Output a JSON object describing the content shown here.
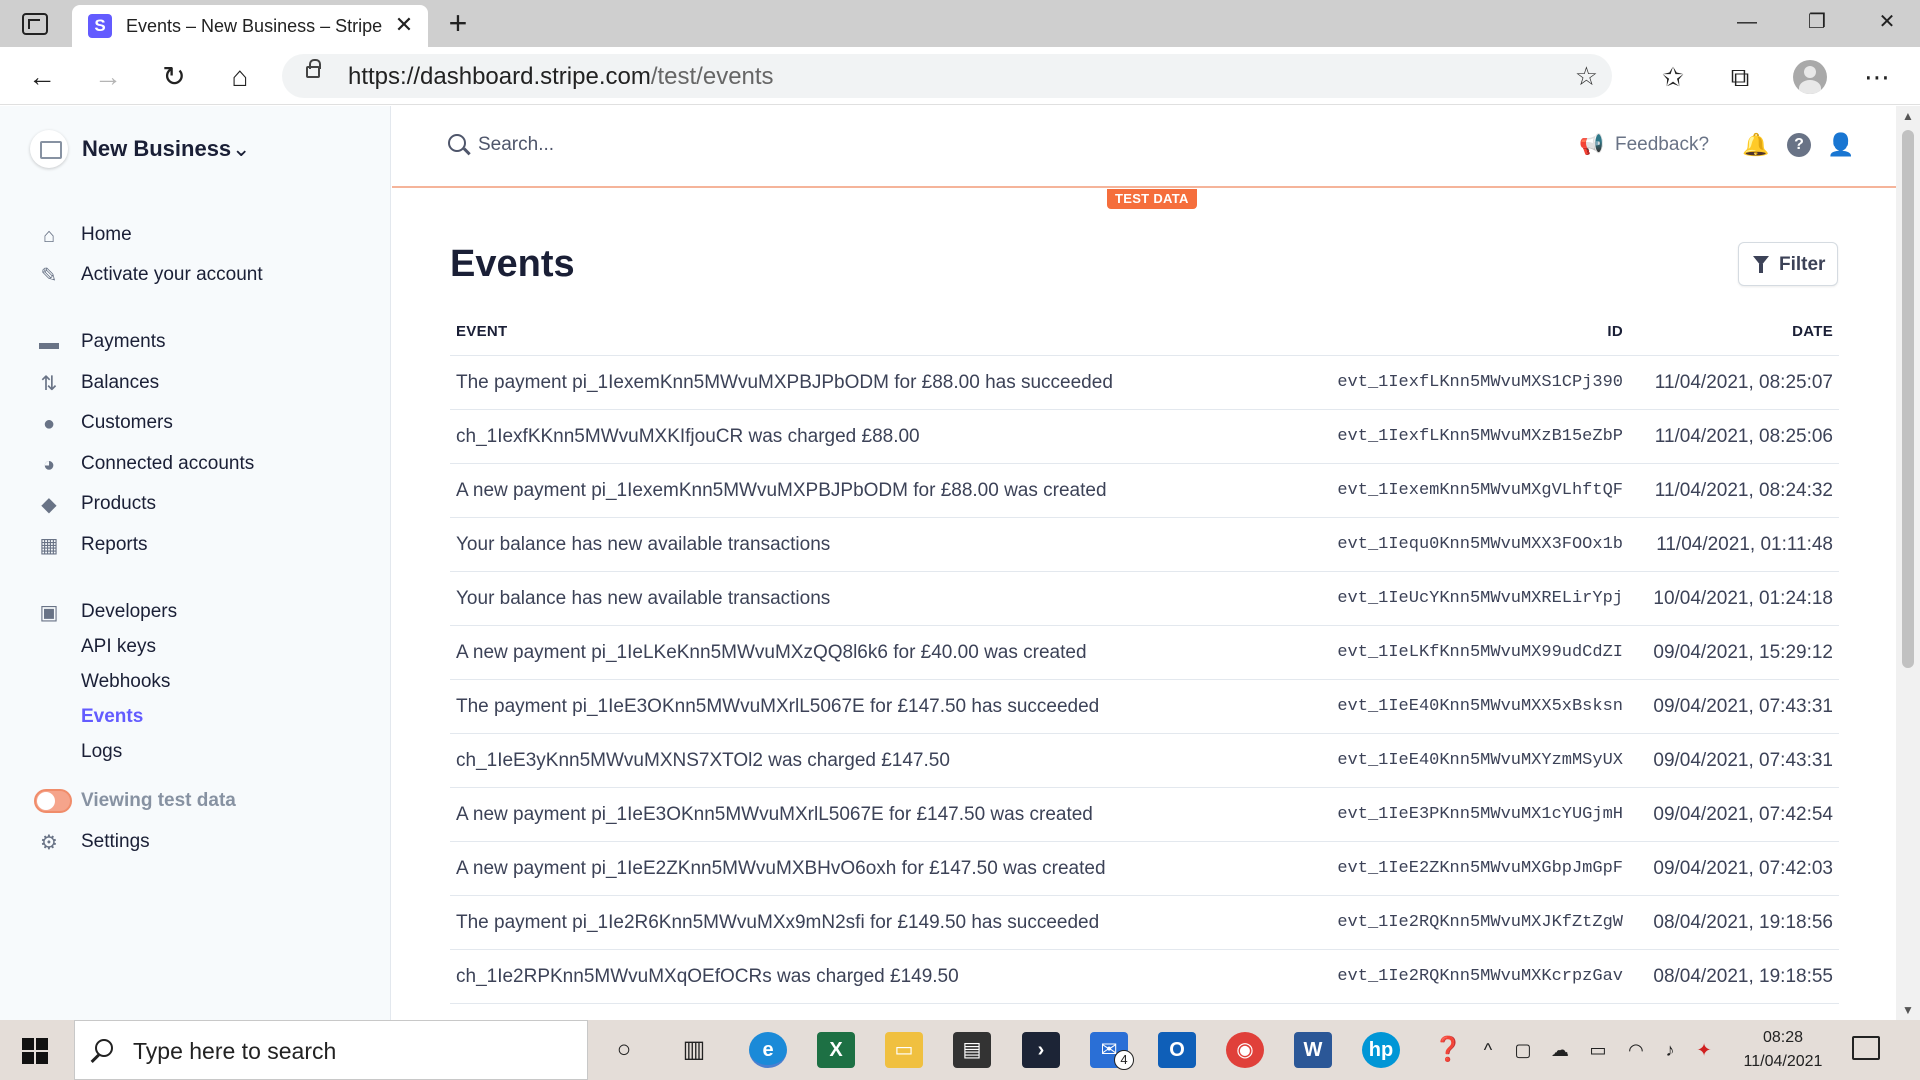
{
  "browser": {
    "tab_title": "Events – New Business – Stripe [Test]",
    "favicon_letter": "S",
    "url_host": "https://dashboard.stripe.com",
    "url_path": "/test/events"
  },
  "sidebar": {
    "business_name": "New Business",
    "items": [
      {
        "label": "Home",
        "icon": "home-icon"
      },
      {
        "label": "Activate your account",
        "icon": "activate-icon"
      },
      {
        "label": "Payments",
        "icon": "payments-icon"
      },
      {
        "label": "Balances",
        "icon": "balances-icon"
      },
      {
        "label": "Customers",
        "icon": "customers-icon"
      },
      {
        "label": "Connected accounts",
        "icon": "connected-accounts-icon"
      },
      {
        "label": "Products",
        "icon": "products-icon"
      },
      {
        "label": "Reports",
        "icon": "reports-icon"
      },
      {
        "label": "Developers",
        "icon": "developers-icon"
      }
    ],
    "developer_items": [
      "API keys",
      "Webhooks",
      "Events",
      "Logs"
    ],
    "active_item": "Events",
    "viewing_test_label": "Viewing test data",
    "settings_label": "Settings"
  },
  "topbar": {
    "search_placeholder": "Search...",
    "feedback_label": "Feedback?",
    "test_badge": "TEST DATA"
  },
  "page": {
    "title": "Events",
    "filter_label": "Filter"
  },
  "table": {
    "columns": {
      "event": "EVENT",
      "id": "ID",
      "date": "DATE"
    },
    "rows": [
      {
        "event": "The payment pi_1IexemKnn5MWvuMXPBJPbODM for £88.00 has succeeded",
        "id": "evt_1IexfLKnn5MWvuMXS1CPj390",
        "date": "11/04/2021, 08:25:07"
      },
      {
        "event": "ch_1IexfKKnn5MWvuMXKIfjouCR was charged £88.00",
        "id": "evt_1IexfLKnn5MWvuMXzB15eZbP",
        "date": "11/04/2021, 08:25:06"
      },
      {
        "event": "A new payment pi_1IexemKnn5MWvuMXPBJPbODM for £88.00 was created",
        "id": "evt_1IexemKnn5MWvuMXgVLhftQF",
        "date": "11/04/2021, 08:24:32"
      },
      {
        "event": "Your balance has new available transactions",
        "id": "evt_1Iequ0Knn5MWvuMXX3FOOx1b",
        "date": "11/04/2021, 01:11:48"
      },
      {
        "event": "Your balance has new available transactions",
        "id": "evt_1IeUcYKnn5MWvuMXRELirYpj",
        "date": "10/04/2021, 01:24:18"
      },
      {
        "event": "A new payment pi_1IeLKeKnn5MWvuMXzQQ8l6k6 for £40.00 was created",
        "id": "evt_1IeLKfKnn5MWvuMX99udCdZI",
        "date": "09/04/2021, 15:29:12"
      },
      {
        "event": "The payment pi_1IeE3OKnn5MWvuMXrlL5067E for £147.50 has succeeded",
        "id": "evt_1IeE40Knn5MWvuMXX5xBsksn",
        "date": "09/04/2021, 07:43:31"
      },
      {
        "event": "ch_1IeE3yKnn5MWvuMXNS7XTOl2 was charged £147.50",
        "id": "evt_1IeE40Knn5MWvuMXYzmMSyUX",
        "date": "09/04/2021, 07:43:31"
      },
      {
        "event": "A new payment pi_1IeE3OKnn5MWvuMXrlL5067E for £147.50 was created",
        "id": "evt_1IeE3PKnn5MWvuMX1cYUGjmH",
        "date": "09/04/2021, 07:42:54"
      },
      {
        "event": "A new payment pi_1IeE2ZKnn5MWvuMXBHvO6oxh for £147.50 was created",
        "id": "evt_1IeE2ZKnn5MWvuMXGbpJmGpF",
        "date": "09/04/2021, 07:42:03"
      },
      {
        "event": "The payment pi_1Ie2R6Knn5MWvuMXx9mN2sfi for £149.50 has succeeded",
        "id": "evt_1Ie2RQKnn5MWvuMXJKfZtZgW",
        "date": "08/04/2021, 19:18:56"
      },
      {
        "event": "ch_1Ie2RPKnn5MWvuMXqOEfOCRs was charged £149.50",
        "id": "evt_1Ie2RQKnn5MWvuMXKcrpzGav",
        "date": "08/04/2021, 19:18:55"
      }
    ]
  },
  "taskbar": {
    "search_placeholder": "Type here to search",
    "time": "08:28",
    "date": "11/04/2021",
    "mail_badge": "4"
  },
  "colors": {
    "accent": "#635bff",
    "test_orange": "#f56e3c",
    "sidebar_bg": "#f7fafc"
  }
}
